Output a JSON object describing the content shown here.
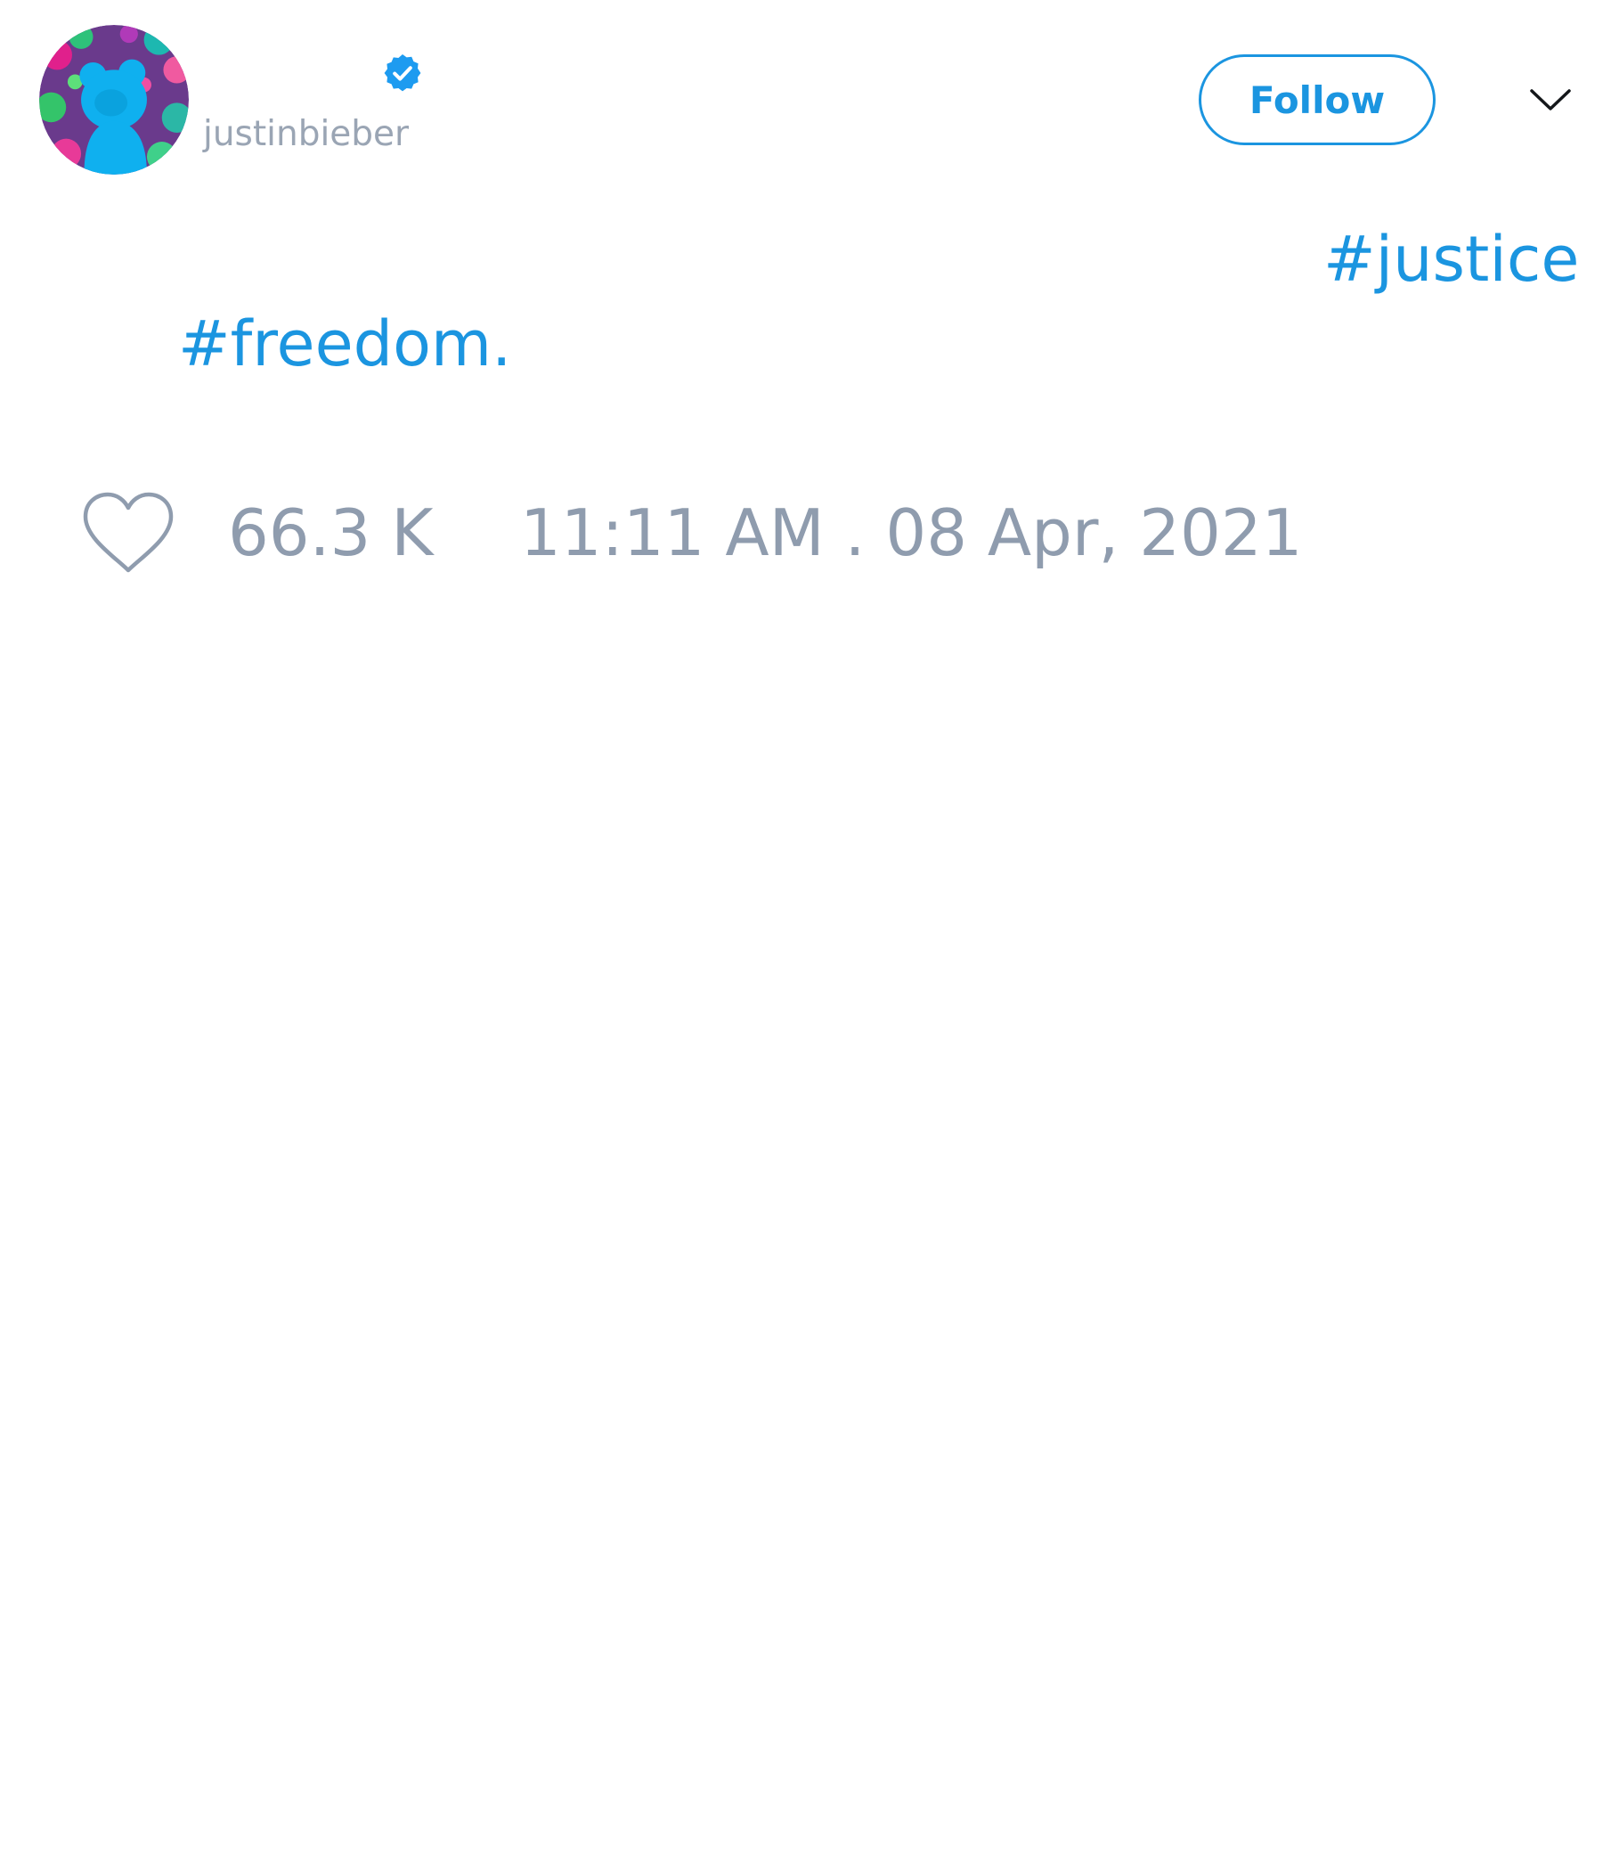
{
  "tweet": {
    "author": {
      "handle": "justinbieber",
      "verified": true,
      "avatar": "profile-avatar"
    },
    "follow_label": "Follow",
    "menu_icon": "chevron-down-icon",
    "hashtags": [
      "#justice",
      "#freedom."
    ],
    "likes": "66.3 K",
    "like_icon": "heart-outline-icon",
    "timestamp": "11:11 AM . 08 Apr, 2021"
  },
  "colors": {
    "accent": "#1b95e0",
    "muted": "#8f9cae",
    "background": "#ffffff"
  }
}
